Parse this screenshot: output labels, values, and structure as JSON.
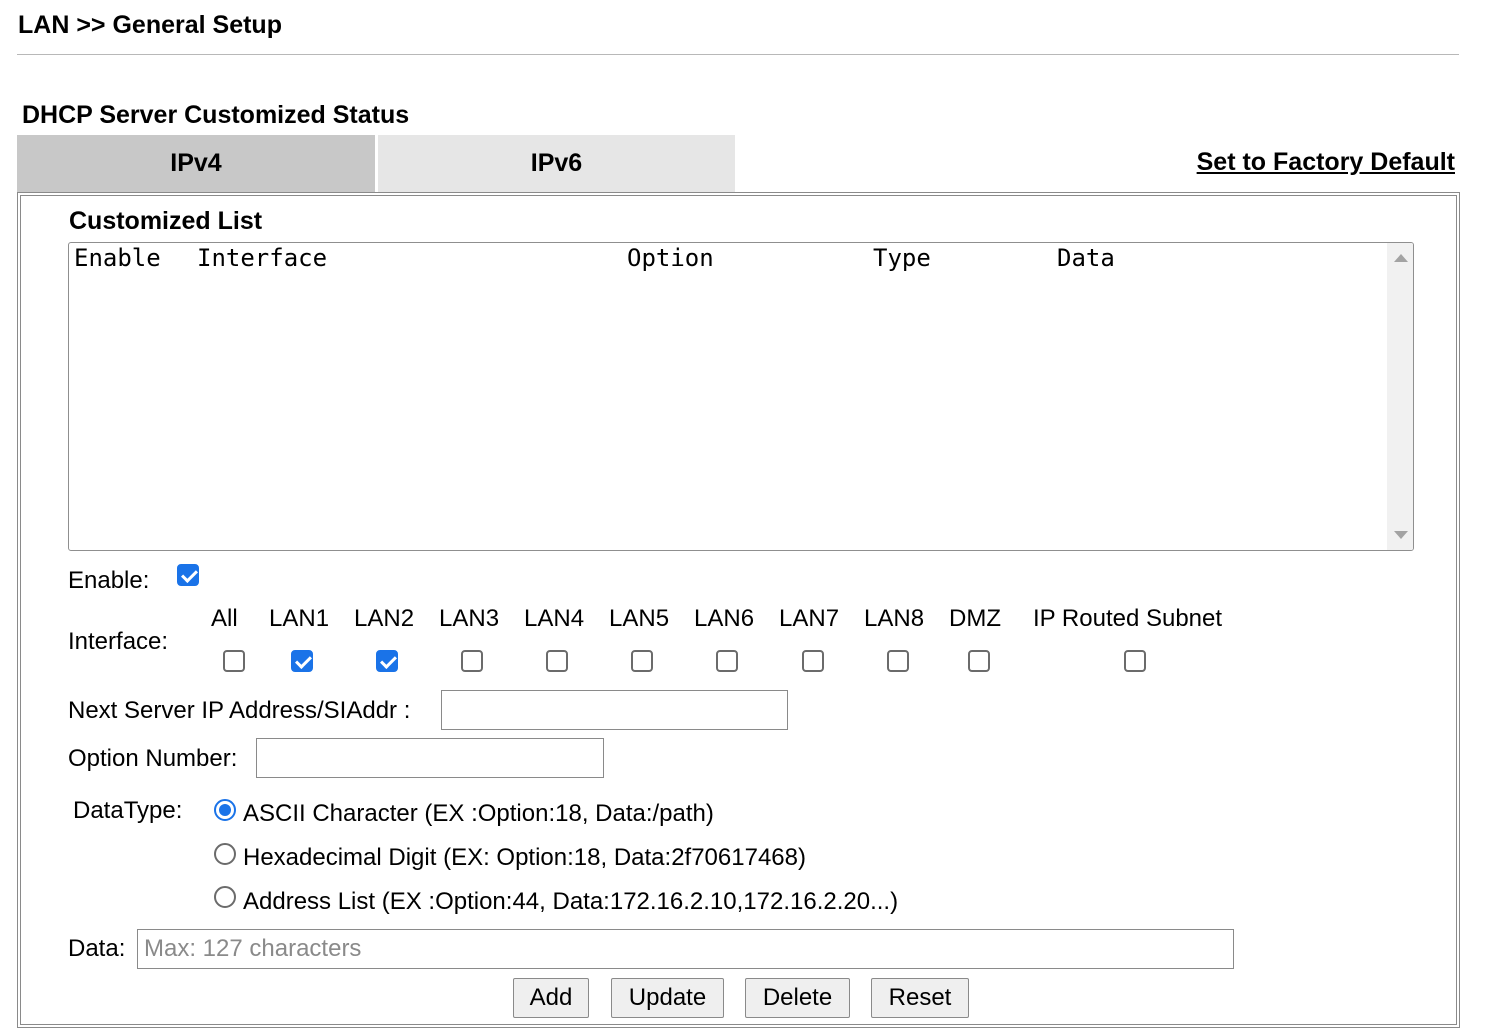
{
  "breadcrumb": "LAN >> General Setup",
  "section_title": "DHCP Server Customized Status",
  "tabs": [
    {
      "label": "IPv4",
      "active": true
    },
    {
      "label": "IPv6",
      "active": false
    }
  ],
  "factory_default_link": "Set to Factory Default",
  "customized_list": {
    "title": "Customized List",
    "columns": [
      "Enable",
      "Interface",
      "Option",
      "Type",
      "Data"
    ],
    "rows": []
  },
  "enable": {
    "label": "Enable:",
    "checked": true
  },
  "interface": {
    "label": "Interface:",
    "options": [
      {
        "label": "All",
        "checked": false
      },
      {
        "label": "LAN1",
        "checked": true
      },
      {
        "label": "LAN2",
        "checked": true
      },
      {
        "label": "LAN3",
        "checked": false
      },
      {
        "label": "LAN4",
        "checked": false
      },
      {
        "label": "LAN5",
        "checked": false
      },
      {
        "label": "LAN6",
        "checked": false
      },
      {
        "label": "LAN7",
        "checked": false
      },
      {
        "label": "LAN8",
        "checked": false
      },
      {
        "label": "DMZ",
        "checked": false
      },
      {
        "label": "IP Routed Subnet",
        "checked": false
      }
    ]
  },
  "next_server": {
    "label": "Next Server IP Address/SIAddr :",
    "value": ""
  },
  "option_number": {
    "label": "Option Number:",
    "value": ""
  },
  "datatype": {
    "label": "DataType:",
    "options": [
      {
        "label": "ASCII Character (EX :Option:18, Data:/path)",
        "selected": true
      },
      {
        "label": "Hexadecimal Digit (EX: Option:18, Data:2f70617468)",
        "selected": false
      },
      {
        "label": "Address List (EX :Option:44, Data:172.16.2.10,172.16.2.20...)",
        "selected": false
      }
    ]
  },
  "data_field": {
    "label": "Data:",
    "value": "",
    "placeholder": "Max: 127 characters"
  },
  "buttons": {
    "add": "Add",
    "update": "Update",
    "delete": "Delete",
    "reset": "Reset"
  },
  "colors": {
    "accent": "#1a73e8",
    "tab_active": "#c8c8c8",
    "tab_inactive": "#e6e6e6"
  }
}
